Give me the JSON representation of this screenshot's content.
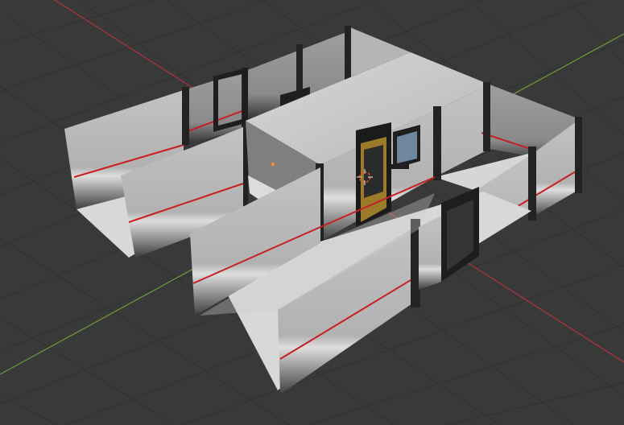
{
  "app": {
    "editor": "3D Viewport"
  },
  "viewport": {
    "background": "#393939",
    "grid_minor_color": "#2f2f2f",
    "grid_major_color": "#4a4a4a",
    "x_axis_color": "#b2353b",
    "y_axis_color": "#6f9c3c",
    "cursor_color": "#ff4a3a",
    "origin_color": "#ff8a2a"
  },
  "materials": {
    "wall_light": "#b9b9b9",
    "wall_mid": "#a7a7a7",
    "wall_dark": "#5f5f5f",
    "floor": "#d6d6d6",
    "ceiling": "#c8c8c8",
    "trim_dark": "#2a2a2a",
    "stripe_red": "#c71f24",
    "stripe_pale": "#d8d8d8",
    "door_frame": "#202020",
    "door_yellow": "#9b7a2a",
    "window_glass": "#6e879f"
  }
}
